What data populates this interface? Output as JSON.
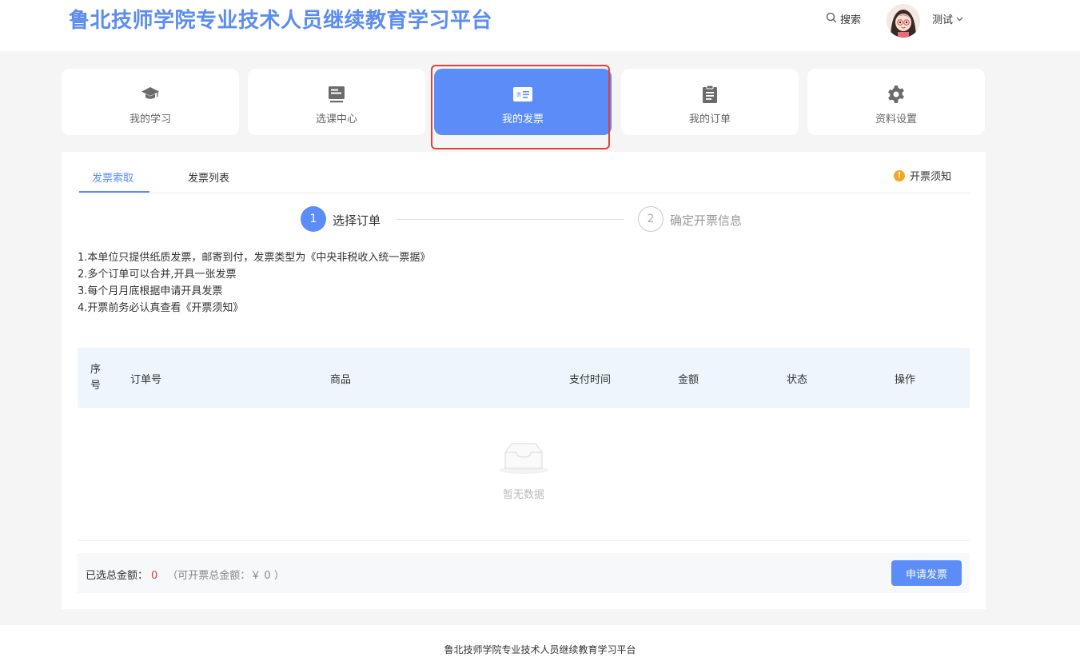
{
  "header": {
    "title": "鲁北技师学院专业技术人员继续教育学习平台",
    "search_label": "搜索",
    "user_name": "测试"
  },
  "nav": [
    {
      "label": "我的学习",
      "icon": "graduation-cap-icon"
    },
    {
      "label": "选课中心",
      "icon": "course-list-icon"
    },
    {
      "label": "我的发票",
      "icon": "invoice-icon"
    },
    {
      "label": "我的订单",
      "icon": "clipboard-icon"
    },
    {
      "label": "资料设置",
      "icon": "gear-icon"
    }
  ],
  "nav_active": "我的发票",
  "tabs": {
    "request": "发票索取",
    "list": "发票列表"
  },
  "notice_label": "开票须知",
  "steps": [
    {
      "num": "1",
      "label": "选择订单"
    },
    {
      "num": "2",
      "label": "确定开票信息"
    }
  ],
  "notes": [
    "1.本单位只提供纸质发票，邮寄到付，发票类型为《中央非税收入统一票据》",
    "2.多个订单可以合并,开具一张发票",
    "3.每个月月底根据申请开具发票",
    "4.开票前务必认真查看《开票须知》"
  ],
  "table": {
    "columns": {
      "index": "序号",
      "order_no": "订单号",
      "product": "商品",
      "pay_time": "支付时间",
      "amount": "金额",
      "status": "状态",
      "action": "操作"
    },
    "empty_text": "暂无数据"
  },
  "summary": {
    "selected_label": "已选总金额：",
    "selected_amount": "0",
    "available": "（可开票总金额：￥ 0 ）"
  },
  "apply_button": "申请发票",
  "footer": "鲁北技师学院专业技术人员继续教育学习平台",
  "colors": {
    "primary": "#5b8cf7",
    "highlight": "#e0413a",
    "warning": "#f5a623"
  }
}
